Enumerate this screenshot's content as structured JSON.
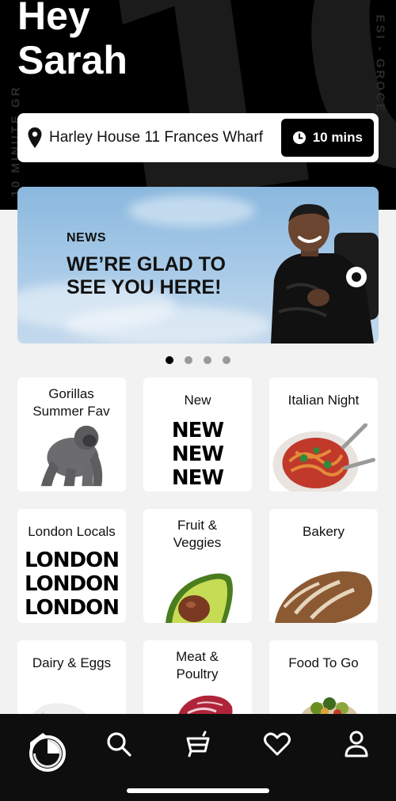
{
  "header": {
    "greeting": "Hey Sarah",
    "background_number": "10",
    "side_text_left": "10 MINUTE GR",
    "side_text_right": "ESI - GROCE",
    "address": "Harley House 11 Frances Wharf",
    "eta": "10 mins"
  },
  "banner": {
    "kicker": "NEWS",
    "title": "WE’RE GLAD TO SEE YOU HERE!",
    "pages": 4,
    "active_page": 1
  },
  "categories": [
    {
      "label": "Gorillas Summer Fav",
      "art": "gorilla-image"
    },
    {
      "label": "New",
      "big_words": [
        "NEW",
        "NEW",
        "NEW"
      ]
    },
    {
      "label": "Italian Night",
      "art": "spaghetti-image"
    },
    {
      "label": "London Locals",
      "big_words": [
        "LONDON",
        "LONDON",
        "LONDON"
      ]
    },
    {
      "label": "Fruit & Veggies",
      "art": "avocado-image"
    },
    {
      "label": "Bakery",
      "art": "bread-image"
    },
    {
      "label": "Dairy & Eggs",
      "art": "milk-image"
    },
    {
      "label": "Meat & Poultry",
      "art": "meat-image"
    },
    {
      "label": "Food To Go",
      "art": "salad-bowl-image"
    }
  ],
  "nav": {
    "items": [
      "home-icon",
      "search-icon",
      "cart-icon",
      "heart-icon",
      "profile-icon"
    ],
    "active": "home-icon"
  },
  "colors": {
    "header_bg": "#000000",
    "accent": "#000000",
    "nav_bg": "#0e0e0e"
  }
}
